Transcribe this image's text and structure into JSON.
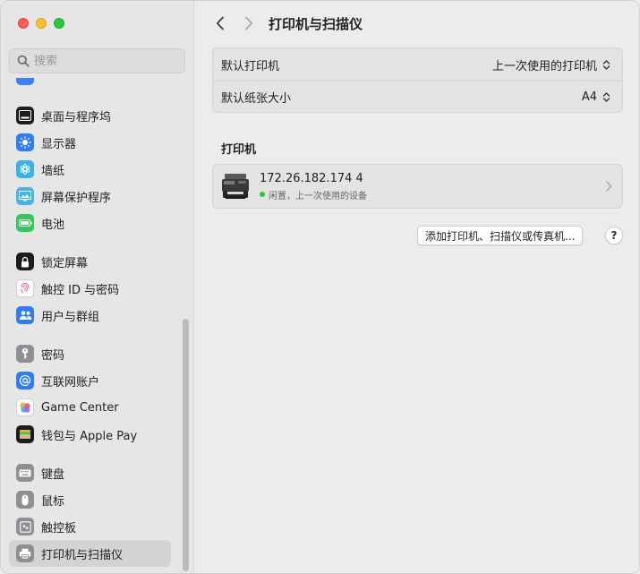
{
  "window": {
    "title": "打印机与扫描仪"
  },
  "search": {
    "placeholder": "搜索"
  },
  "sidebar": {
    "items": [
      {
        "label": "桌面与程序坞",
        "icon": "dock-icon",
        "color": "#1c1c1e"
      },
      {
        "label": "显示器",
        "icon": "display-brightness-icon",
        "color": "#2f7cf6"
      },
      {
        "label": "墙纸",
        "icon": "wallpaper-flower-icon",
        "color": "#35b3e9"
      },
      {
        "label": "屏幕保护程序",
        "icon": "screensaver-icon",
        "color": "#45b5e8"
      },
      {
        "label": "电池",
        "icon": "battery-icon",
        "color": "#34c759"
      },
      {
        "label": "锁定屏幕",
        "icon": "lock-icon",
        "color": "#1c1c1e"
      },
      {
        "label": "触控 ID 与密码",
        "icon": "fingerprint-icon",
        "color": "#ffffff"
      },
      {
        "label": "用户与群组",
        "icon": "users-icon",
        "color": "#2f7cf6"
      },
      {
        "label": "密码",
        "icon": "key-icon",
        "color": "#8e8e93"
      },
      {
        "label": "互联网账户",
        "icon": "at-icon",
        "color": "#2f7cf6"
      },
      {
        "label": "Game Center",
        "icon": "game-center-icon",
        "color": "#ffffff"
      },
      {
        "label": "钱包与 Apple Pay",
        "icon": "wallet-icon",
        "color": "#1c1c1e"
      },
      {
        "label": "键盘",
        "icon": "keyboard-icon",
        "color": "#8e8e93"
      },
      {
        "label": "鼠标",
        "icon": "mouse-icon",
        "color": "#8e8e93"
      },
      {
        "label": "触控板",
        "icon": "trackpad-icon",
        "color": "#8e8e93"
      },
      {
        "label": "打印机与扫描仪",
        "icon": "printer-icon",
        "color": "#8e8e93",
        "selected": true
      }
    ]
  },
  "main": {
    "title": "打印机与扫描仪",
    "defaults": {
      "printer_label": "默认打印机",
      "printer_value": "上一次使用的打印机",
      "paper_label": "默认纸张大小",
      "paper_value": "A4"
    },
    "printers_heading": "打印机",
    "printer": {
      "name": "172.26.182.174 4",
      "status": "闲置，上一次使用的设备",
      "status_color": "#28c840"
    },
    "add_button": "添加打印机、扫描仪或传真机...",
    "help_button": "?"
  }
}
